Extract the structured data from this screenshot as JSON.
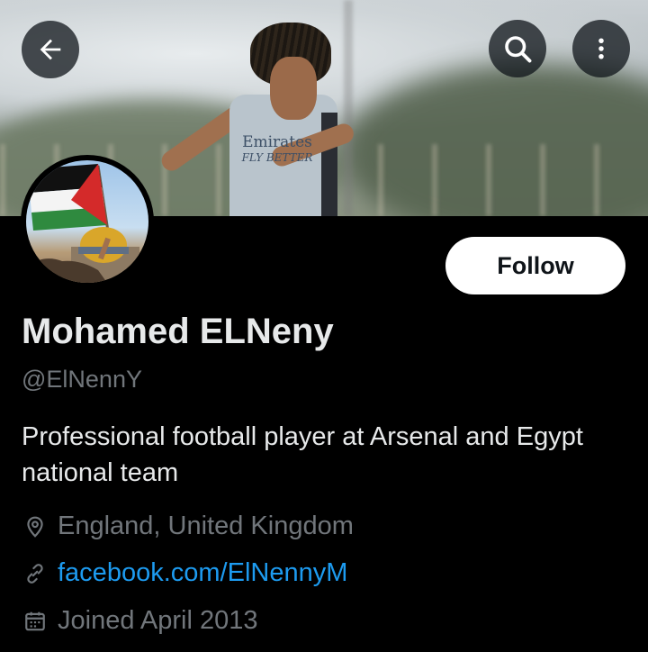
{
  "header": {
    "back_icon": "arrow-left-icon",
    "search_icon": "search-icon",
    "more_icon": "more-vertical-icon"
  },
  "banner": {
    "sponsor_name": "Emirates",
    "sponsor_tagline": "FLY BETTER"
  },
  "profile": {
    "display_name": "Mohamed ELNeny",
    "handle": "@ElNennY",
    "follow_label": "Follow",
    "bio": "Professional football player at Arsenal and Egypt national team",
    "location": "England, United Kingdom",
    "website": "facebook.com/ElNennyM",
    "joined": "Joined April 2013"
  },
  "icons": {
    "location": "location-pin-icon",
    "link": "link-icon",
    "calendar": "calendar-icon"
  },
  "colors": {
    "background": "#000000",
    "text_primary": "#e7e9ea",
    "text_secondary": "#71767b",
    "link": "#1d9bf0",
    "follow_bg": "#ffffff"
  }
}
